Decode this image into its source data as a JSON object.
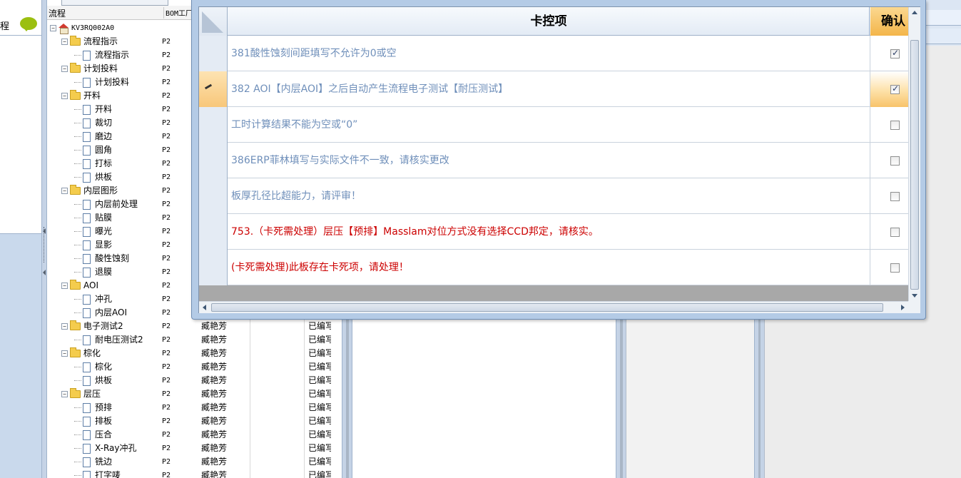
{
  "left_panel": {
    "label": "程"
  },
  "tree": {
    "header_col1": "流程",
    "header_col2": "BOM工厂",
    "rows": [
      {
        "label": "KV3RQ002A0",
        "type": "root",
        "level": 0,
        "col2": ""
      },
      {
        "label": "流程指示",
        "type": "folder",
        "level": 1,
        "col2": "P2"
      },
      {
        "label": "流程指示",
        "type": "doc",
        "level": 2,
        "col2": "P2"
      },
      {
        "label": "计划投料",
        "type": "folder",
        "level": 1,
        "col2": "P2"
      },
      {
        "label": "计划投料",
        "type": "doc",
        "level": 2,
        "col2": "P2"
      },
      {
        "label": "开料",
        "type": "folder",
        "level": 1,
        "col2": "P2"
      },
      {
        "label": "开料",
        "type": "doc",
        "level": 2,
        "col2": "P2"
      },
      {
        "label": "裁切",
        "type": "doc",
        "level": 2,
        "col2": "P2"
      },
      {
        "label": "磨边",
        "type": "doc",
        "level": 2,
        "col2": "P2"
      },
      {
        "label": "圆角",
        "type": "doc",
        "level": 2,
        "col2": "P2"
      },
      {
        "label": "打标",
        "type": "doc",
        "level": 2,
        "col2": "P2"
      },
      {
        "label": "烘板",
        "type": "doc",
        "level": 2,
        "col2": "P2"
      },
      {
        "label": "内层图形",
        "type": "folder",
        "level": 1,
        "col2": "P2"
      },
      {
        "label": "内层前处理",
        "type": "doc",
        "level": 2,
        "col2": "P2"
      },
      {
        "label": "贴膜",
        "type": "doc",
        "level": 2,
        "col2": "P2"
      },
      {
        "label": "曝光",
        "type": "doc",
        "level": 2,
        "col2": "P2"
      },
      {
        "label": "显影",
        "type": "doc",
        "level": 2,
        "col2": "P2"
      },
      {
        "label": "酸性蚀刻",
        "type": "doc",
        "level": 2,
        "col2": "P2"
      },
      {
        "label": "退膜",
        "type": "doc",
        "level": 2,
        "col2": "P2"
      },
      {
        "label": "AOI",
        "type": "folder",
        "level": 1,
        "col2": "P2"
      },
      {
        "label": "冲孔",
        "type": "doc",
        "level": 2,
        "col2": "P2"
      },
      {
        "label": "内层AOI",
        "type": "doc",
        "level": 2,
        "col2": "P2"
      },
      {
        "label": "电子测试2",
        "type": "folder",
        "level": 1,
        "col2": "P2"
      },
      {
        "label": "耐电压测试2",
        "type": "doc",
        "level": 2,
        "col2": "P2"
      },
      {
        "label": "棕化",
        "type": "folder",
        "level": 1,
        "col2": "P2"
      },
      {
        "label": "棕化",
        "type": "doc",
        "level": 2,
        "col2": "P2"
      },
      {
        "label": "烘板",
        "type": "doc",
        "level": 2,
        "col2": "P2"
      },
      {
        "label": "层压",
        "type": "folder",
        "level": 1,
        "col2": "P2"
      },
      {
        "label": "预排",
        "type": "doc",
        "level": 2,
        "col2": "P2"
      },
      {
        "label": "排板",
        "type": "doc",
        "level": 2,
        "col2": "P2"
      },
      {
        "label": "压合",
        "type": "doc",
        "level": 2,
        "col2": "P2"
      },
      {
        "label": "X-Ray冲孔",
        "type": "doc",
        "level": 2,
        "col2": "P2"
      },
      {
        "label": "铣边",
        "type": "doc",
        "level": 2,
        "col2": "P2"
      },
      {
        "label": "打字唛",
        "type": "doc",
        "level": 2,
        "col2": "P2"
      }
    ]
  },
  "mid_grid": {
    "rows": [
      {
        "operator": "臧艳芳",
        "status": "已编写"
      },
      {
        "operator": "臧艳芳",
        "status": "已编写"
      },
      {
        "operator": "臧艳芳",
        "status": "已编写"
      },
      {
        "operator": "臧艳芳",
        "status": "已编写"
      },
      {
        "operator": "臧艳芳",
        "status": "已编写"
      },
      {
        "operator": "臧艳芳",
        "status": "已编写"
      },
      {
        "operator": "臧艳芳",
        "status": "已编写"
      },
      {
        "operator": "臧艳芳",
        "status": "已编写"
      },
      {
        "operator": "臧艳芳",
        "status": "已编写"
      },
      {
        "operator": "臧艳芳",
        "status": "已编写"
      },
      {
        "operator": "臧艳芳",
        "status": "已编写"
      },
      {
        "operator": "臧艳芳",
        "status": "已编写"
      }
    ]
  },
  "dialog": {
    "header_item": "卡控项",
    "header_confirm": "确认",
    "rows": [
      {
        "text": "381酸性蚀刻间距填写不允许为0或空",
        "checked": true,
        "red": false,
        "selected": false
      },
      {
        "text": "382 AOI【内层AOI】之后自动产生流程电子测试【耐压测试】",
        "checked": true,
        "red": false,
        "selected": true
      },
      {
        "text": "工时计算结果不能为空或“0”",
        "checked": false,
        "red": false,
        "selected": false
      },
      {
        "text": "386ERP菲林填写与实际文件不一致，请核实更改",
        "checked": false,
        "red": false,
        "selected": false
      },
      {
        "text": "板厚孔径比超能力，请评审！",
        "checked": false,
        "red": false,
        "selected": false
      },
      {
        "text": "753.（卡死需处理）层压【预排】Masslam对位方式没有选择CCD邦定，请核实。",
        "checked": false,
        "red": true,
        "selected": false
      },
      {
        "text": "(卡死需处理)此板存在卡死项，请处理！",
        "checked": false,
        "red": true,
        "selected": false
      }
    ]
  },
  "colors": {
    "text_blue": "#6f8fba",
    "text_red": "#cc0000",
    "confirm_header": "#f3b54a",
    "dialog_frame": "#b4cbe6"
  }
}
